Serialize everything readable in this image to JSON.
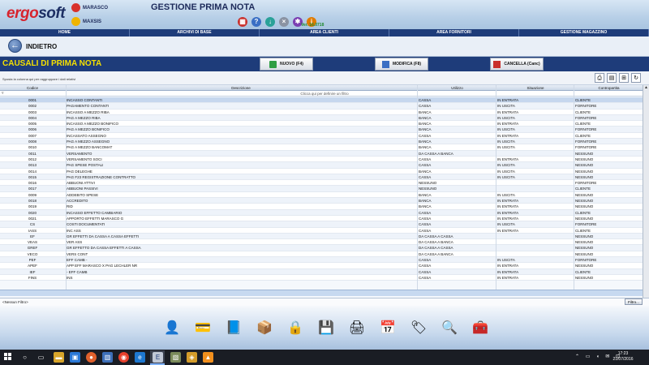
{
  "header": {
    "logo_a": "ergo",
    "logo_b": "soft",
    "users": [
      "MARASCO",
      "MAXSIS"
    ],
    "app_title": "GESTIONE PRIMA NOTA",
    "version": "Ver. 16.0718"
  },
  "menu": [
    "HOME",
    "ARCHIVI DI BASE",
    "AREA CLIENTI",
    "AREA FORNITORI",
    "GESTIONE MAGAZZINO"
  ],
  "nav": {
    "back_label": "INDIETRO"
  },
  "section": {
    "title": "CAUSALI DI PRIMA NOTA",
    "btn_new": "NUOVO (F4)",
    "btn_edit": "MODIFICA (F8)",
    "btn_delete": "CANCELLA (Canc)"
  },
  "grid": {
    "group_hint": "Sposta la colonna qui per raggruppare i dati relativi",
    "filter_hint": "Clicca qui per definire un filtro",
    "columns": [
      "Codice",
      "Descrizione",
      "Utilizzo",
      "Situazione",
      "Contropartita"
    ],
    "rows": [
      [
        "0001",
        "INCASSO CONTANTI",
        "CASSA",
        "IN ENTRATA",
        "CLIENTE"
      ],
      [
        "0002",
        "PAGAMENTO CONTANTI",
        "CASSA",
        "IN USCITA",
        "FORNITORE"
      ],
      [
        "0003",
        "INCASSO A MEZZO RIBA",
        "BANCA",
        "IN ENTRATA",
        "CLIENTE"
      ],
      [
        "0004",
        "PAG A MEZZO RIBA",
        "BANCA",
        "IN USCITA",
        "FORNITORE"
      ],
      [
        "0005",
        "INCASSO A MEZZO BONIFICO",
        "BANCA",
        "IN ENTRATA",
        "CLIENTE"
      ],
      [
        "0006",
        "PAG A MEZZO BONIFICO",
        "BANCA",
        "IN USCITA",
        "FORNITORE"
      ],
      [
        "0007",
        "INCASSATO ASSEGNO",
        "CASSA",
        "IN ENTRATA",
        "CLIENTE"
      ],
      [
        "0008",
        "PAG A MEZZO ASSEGNO",
        "BANCA",
        "IN USCITA",
        "FORNITORE"
      ],
      [
        "0010",
        "PAG A MEZZO BANCOMAT",
        "BANCA",
        "IN USCITA",
        "FORNITORE"
      ],
      [
        "0011",
        "VERSAMENTO",
        "DA CASSA A BANCA",
        "",
        "NESSUNO"
      ],
      [
        "0012",
        "VERSAMENTO SOCI",
        "CASSA",
        "IN ENTRATA",
        "NESSUNO"
      ],
      [
        "0013",
        "PAG SPESE POSTALI",
        "CASSA",
        "IN USCITA",
        "NESSUNO"
      ],
      [
        "0014",
        "PAG DELEGHE",
        "BANCA",
        "IN USCITA",
        "NESSUNO"
      ],
      [
        "0015",
        "PAG F23 REGISTRAZIONE CONTRATTO",
        "CASSA",
        "IN USCITA",
        "NESSUNO"
      ],
      [
        "0016",
        "ABBUONI ATTIVI",
        "NESSUNO",
        "",
        "FORNITORE"
      ],
      [
        "0017",
        "ABBUONI PASSIVI",
        "NESSUNO",
        "",
        "CLIENTE"
      ],
      [
        "0009",
        "ADDEBITO SPESE",
        "BANCA",
        "IN USCITA",
        "NESSUNO"
      ],
      [
        "0018",
        "ACCREDITO",
        "BANCA",
        "IN ENTRATA",
        "NESSUNO"
      ],
      [
        "0019",
        "RID",
        "BANCA",
        "IN ENTRATA",
        "NESSUNO"
      ],
      [
        "0020",
        "INCASSO EFFETTO CAMBIARIO",
        "CASSA",
        "IN ENTRATA",
        "CLIENTE"
      ],
      [
        "0021",
        "APPORTO EFFETTI MARASCO G",
        "CASSA",
        "IN ENTRATA",
        "NESSUNO"
      ],
      [
        "CS",
        "COSTI DOCUMENTATI",
        "CASSA",
        "IN USCITA",
        "FORNITORE"
      ],
      [
        "IASS",
        "INC ASS",
        "CASSA",
        "IN ENTRATA",
        "CLIENTE"
      ],
      [
        "EF",
        "GR EFFETTI DA CASSA A CASSA EFFETTI",
        "DA CASSA A CASSA",
        "",
        "NESSUNO"
      ],
      [
        "VEAS",
        "VER ASS",
        "DA CASSA A BANCA",
        "",
        "NESSUNO"
      ],
      [
        "GREF",
        "GR EFFETTO DA CASSA EFFETTI A CASSA",
        "DA CASSA A CASSA",
        "",
        "NESSUNO"
      ],
      [
        "VECO",
        "VERS CONT",
        "DA CASSA A BANCA",
        "",
        "NESSUNO"
      ],
      [
        "PEF",
        "EFF CAMB -",
        "CASSA",
        "IN USCITA",
        "FORNITORE"
      ],
      [
        "APEF",
        "APP EFF MARASCO X PAG LECHLER NR",
        "CASSA",
        "IN ENTRATA",
        "NESSUNO"
      ],
      [
        "IEF",
        "- EFF CAMB",
        "CASSA",
        "IN ENTRATA",
        "CLIENTE"
      ],
      [
        "FINS",
        "INS",
        "CASSA",
        "IN ENTRATA",
        "NESSUNO"
      ]
    ],
    "footer_filter": "<Nessun Filtro>",
    "filter_btn": "Filtro..."
  },
  "taskbar": {
    "time": "17:23",
    "date": "21/07/2016"
  }
}
